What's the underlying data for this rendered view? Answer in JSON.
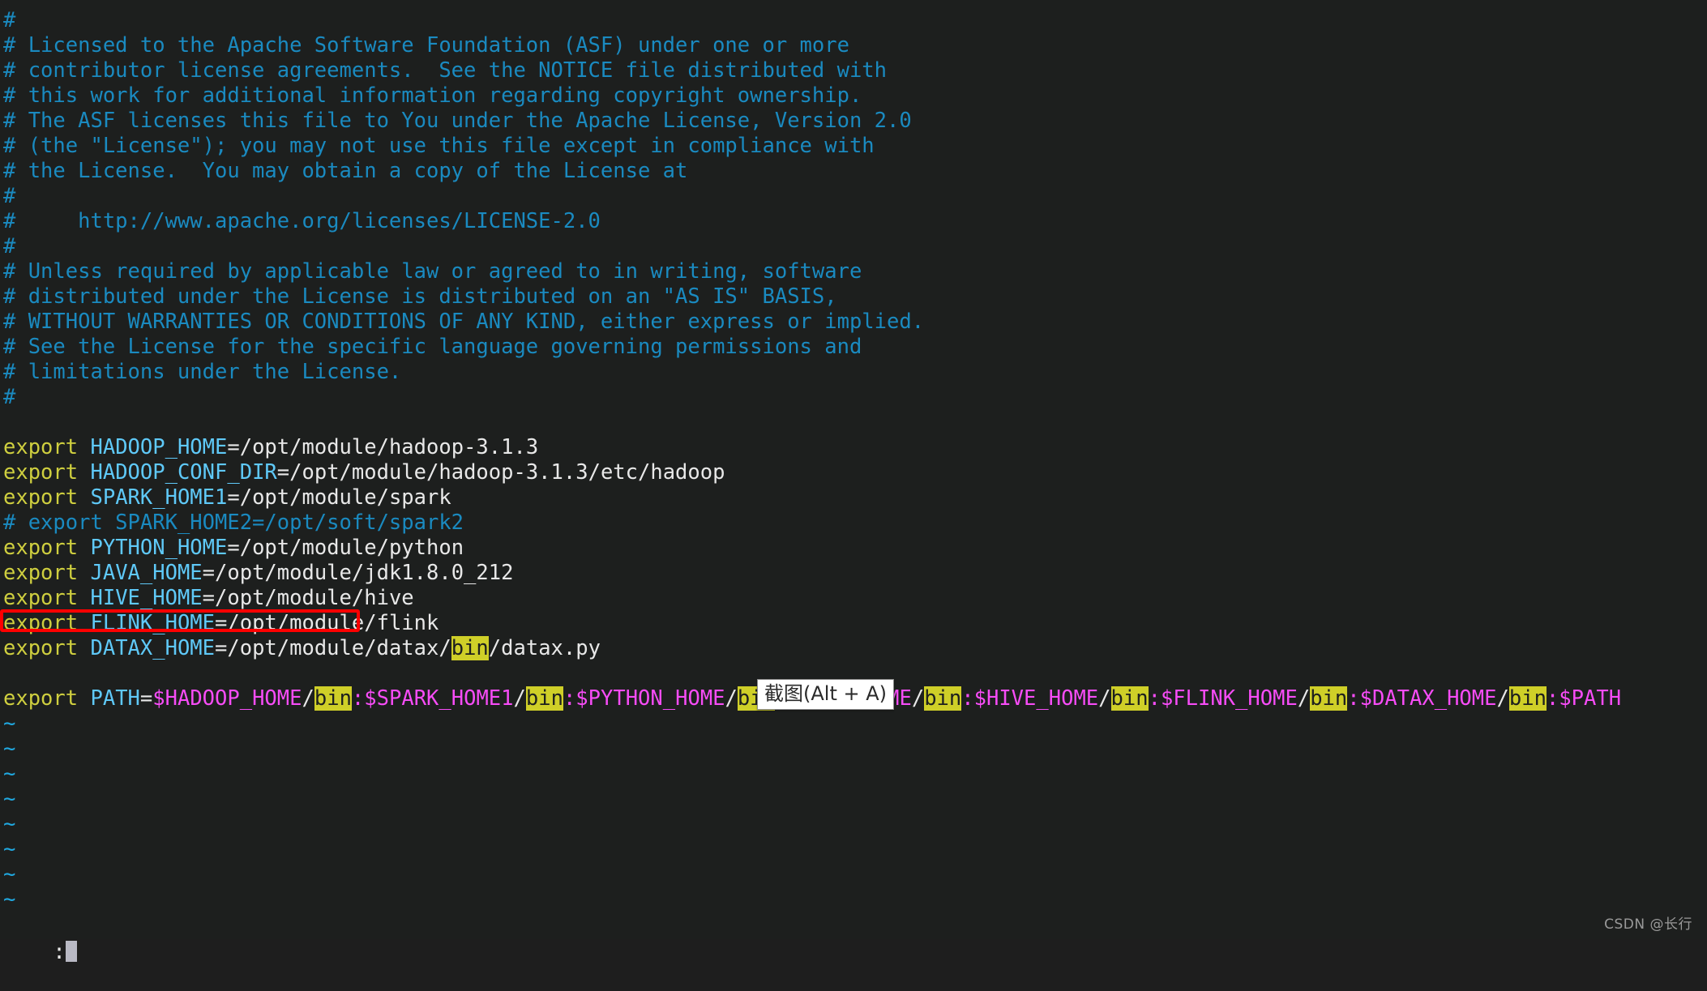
{
  "editor": {
    "app": "vim",
    "colors": {
      "background": "#1d1f1e",
      "comment": "#1a8ac0",
      "keyword": "#cfcf3f",
      "variable": "#5fc9f8",
      "path": "#e8e8e8",
      "dollar_var": "#f74cf7",
      "search_highlight_bg": "#cfcf28",
      "tilde": "#20a8e0",
      "annotation_box": "#ff0000"
    },
    "lines": [
      {
        "id": "l1",
        "segments": [
          {
            "text": "#",
            "style": "comment"
          }
        ]
      },
      {
        "id": "l2",
        "segments": [
          {
            "text": "# Licensed to the Apache Software Foundation (ASF) under one or more",
            "style": "comment"
          }
        ]
      },
      {
        "id": "l3",
        "segments": [
          {
            "text": "# contributor license agreements.  See the NOTICE file distributed with",
            "style": "comment"
          }
        ]
      },
      {
        "id": "l4",
        "segments": [
          {
            "text": "# this work for additional information regarding copyright ownership.",
            "style": "comment"
          }
        ]
      },
      {
        "id": "l5",
        "segments": [
          {
            "text": "# The ASF licenses this file to You under the Apache License, Version 2.0",
            "style": "comment"
          }
        ]
      },
      {
        "id": "l6",
        "segments": [
          {
            "text": "# (the \"License\"); you may not use this file except in compliance with",
            "style": "comment"
          }
        ]
      },
      {
        "id": "l7",
        "segments": [
          {
            "text": "# the License.  You may obtain a copy of the License at",
            "style": "comment"
          }
        ]
      },
      {
        "id": "l8",
        "segments": [
          {
            "text": "#",
            "style": "comment"
          }
        ]
      },
      {
        "id": "l9",
        "segments": [
          {
            "text": "#     http://www.apache.org/licenses/LICENSE-2.0",
            "style": "comment"
          }
        ]
      },
      {
        "id": "l10",
        "segments": [
          {
            "text": "#",
            "style": "comment"
          }
        ]
      },
      {
        "id": "l11",
        "segments": [
          {
            "text": "# Unless required by applicable law or agreed to in writing, software",
            "style": "comment"
          }
        ]
      },
      {
        "id": "l12",
        "segments": [
          {
            "text": "# distributed under the License is distributed on an \"AS IS\" BASIS,",
            "style": "comment"
          }
        ]
      },
      {
        "id": "l13",
        "segments": [
          {
            "text": "# WITHOUT WARRANTIES OR CONDITIONS OF ANY KIND, either express or implied.",
            "style": "comment"
          }
        ]
      },
      {
        "id": "l14",
        "segments": [
          {
            "text": "# See the License for the specific language governing permissions and",
            "style": "comment"
          }
        ]
      },
      {
        "id": "l15",
        "segments": [
          {
            "text": "# limitations under the License.",
            "style": "comment"
          }
        ]
      },
      {
        "id": "l16",
        "segments": [
          {
            "text": "#",
            "style": "comment"
          }
        ]
      },
      {
        "id": "l17",
        "segments": [
          {
            "text": " ",
            "style": "blank"
          }
        ]
      },
      {
        "id": "l18",
        "segments": [
          {
            "text": "export",
            "style": "keyword"
          },
          {
            "text": " ",
            "style": "path"
          },
          {
            "text": "HADOOP_HOME",
            "style": "var"
          },
          {
            "text": "=/opt/module/hadoop-3.1.3",
            "style": "path"
          }
        ]
      },
      {
        "id": "l19",
        "segments": [
          {
            "text": "export",
            "style": "keyword"
          },
          {
            "text": " ",
            "style": "path"
          },
          {
            "text": "HADOOP_CONF_DIR",
            "style": "var"
          },
          {
            "text": "=/opt/module/hadoop-3.1.3/etc/hadoop",
            "style": "path"
          }
        ]
      },
      {
        "id": "l20",
        "segments": [
          {
            "text": "export",
            "style": "keyword"
          },
          {
            "text": " ",
            "style": "path"
          },
          {
            "text": "SPARK_HOME1",
            "style": "var"
          },
          {
            "text": "=/opt/module/spark",
            "style": "path"
          }
        ]
      },
      {
        "id": "l21",
        "segments": [
          {
            "text": "# export SPARK_HOME2=/opt/soft/spark2",
            "style": "comment"
          }
        ]
      },
      {
        "id": "l22",
        "segments": [
          {
            "text": "export",
            "style": "keyword"
          },
          {
            "text": " ",
            "style": "path"
          },
          {
            "text": "PYTHON_HOME",
            "style": "var"
          },
          {
            "text": "=/opt/module/python",
            "style": "path"
          }
        ]
      },
      {
        "id": "l23",
        "segments": [
          {
            "text": "export",
            "style": "keyword"
          },
          {
            "text": " ",
            "style": "path"
          },
          {
            "text": "JAVA_HOME",
            "style": "var"
          },
          {
            "text": "=/opt/module/jdk1.8.0_212",
            "style": "path"
          }
        ]
      },
      {
        "id": "l24",
        "segments": [
          {
            "text": "export",
            "style": "keyword"
          },
          {
            "text": " ",
            "style": "path"
          },
          {
            "text": "HIVE_HOME",
            "style": "var"
          },
          {
            "text": "=/opt/module/hive",
            "style": "path"
          }
        ]
      },
      {
        "id": "l25",
        "segments": [
          {
            "text": "export",
            "style": "keyword"
          },
          {
            "text": " ",
            "style": "path"
          },
          {
            "text": "FLINK_HOME",
            "style": "var"
          },
          {
            "text": "=/opt/module/flink",
            "style": "path"
          }
        ]
      },
      {
        "id": "l26",
        "segments": [
          {
            "text": "export",
            "style": "keyword"
          },
          {
            "text": " ",
            "style": "path"
          },
          {
            "text": "DATAX_HOME",
            "style": "var"
          },
          {
            "text": "=/opt/module/datax/",
            "style": "path"
          },
          {
            "text": "bin",
            "style": "hl"
          },
          {
            "text": "/datax.py",
            "style": "path"
          }
        ]
      },
      {
        "id": "l27",
        "segments": [
          {
            "text": " ",
            "style": "blank"
          }
        ]
      },
      {
        "id": "l28",
        "segments": [
          {
            "text": "export",
            "style": "keyword"
          },
          {
            "text": " ",
            "style": "path"
          },
          {
            "text": "PATH",
            "style": "var"
          },
          {
            "text": "=",
            "style": "path"
          },
          {
            "text": "$HADOOP_HOME",
            "style": "dollar"
          },
          {
            "text": "/",
            "style": "path"
          },
          {
            "text": "bin",
            "style": "hl"
          },
          {
            "text": ":",
            "style": "dollar"
          },
          {
            "text": "$SPARK_HOME1",
            "style": "dollar"
          },
          {
            "text": "/",
            "style": "path"
          },
          {
            "text": "bin",
            "style": "hl"
          },
          {
            "text": ":",
            "style": "dollar"
          },
          {
            "text": "$PYTHON_HOME",
            "style": "dollar"
          },
          {
            "text": "/",
            "style": "path"
          },
          {
            "text": "bin",
            "style": "hl"
          },
          {
            "text": ":",
            "style": "dollar"
          },
          {
            "text": "$JAVA_HOME",
            "style": "dollar"
          },
          {
            "text": "/",
            "style": "path"
          },
          {
            "text": "bin",
            "style": "hl"
          },
          {
            "text": ":",
            "style": "dollar"
          },
          {
            "text": "$HIVE_HOME",
            "style": "dollar"
          },
          {
            "text": "/",
            "style": "path"
          },
          {
            "text": "bin",
            "style": "hl"
          },
          {
            "text": ":",
            "style": "dollar"
          },
          {
            "text": "$FLINK_HOME",
            "style": "dollar"
          },
          {
            "text": "/",
            "style": "path"
          },
          {
            "text": "bin",
            "style": "hl"
          },
          {
            "text": ":",
            "style": "dollar"
          },
          {
            "text": "$DATAX_HOME",
            "style": "dollar"
          },
          {
            "text": "/",
            "style": "path"
          },
          {
            "text": "bin",
            "style": "hl"
          },
          {
            "text": ":",
            "style": "dollar"
          },
          {
            "text": "$PATH",
            "style": "dollar"
          }
        ]
      },
      {
        "id": "l29",
        "segments": [
          {
            "text": "~",
            "style": "tilde"
          }
        ]
      },
      {
        "id": "l30",
        "segments": [
          {
            "text": "~",
            "style": "tilde"
          }
        ]
      },
      {
        "id": "l31",
        "segments": [
          {
            "text": "~",
            "style": "tilde"
          }
        ]
      },
      {
        "id": "l32",
        "segments": [
          {
            "text": "~",
            "style": "tilde"
          }
        ]
      },
      {
        "id": "l33",
        "segments": [
          {
            "text": "~",
            "style": "tilde"
          }
        ]
      },
      {
        "id": "l34",
        "segments": [
          {
            "text": "~",
            "style": "tilde"
          }
        ]
      },
      {
        "id": "l35",
        "segments": [
          {
            "text": "~",
            "style": "tilde"
          }
        ]
      },
      {
        "id": "l36",
        "segments": [
          {
            "text": "~",
            "style": "tilde"
          }
        ]
      }
    ]
  },
  "status_bar": {
    "command_prompt": ":"
  },
  "annotation": {
    "flink_box_label": "highlight-box-flink-home"
  },
  "tooltip": {
    "label": "截图(Alt + A)"
  },
  "watermark": {
    "text": "CSDN @长行"
  }
}
